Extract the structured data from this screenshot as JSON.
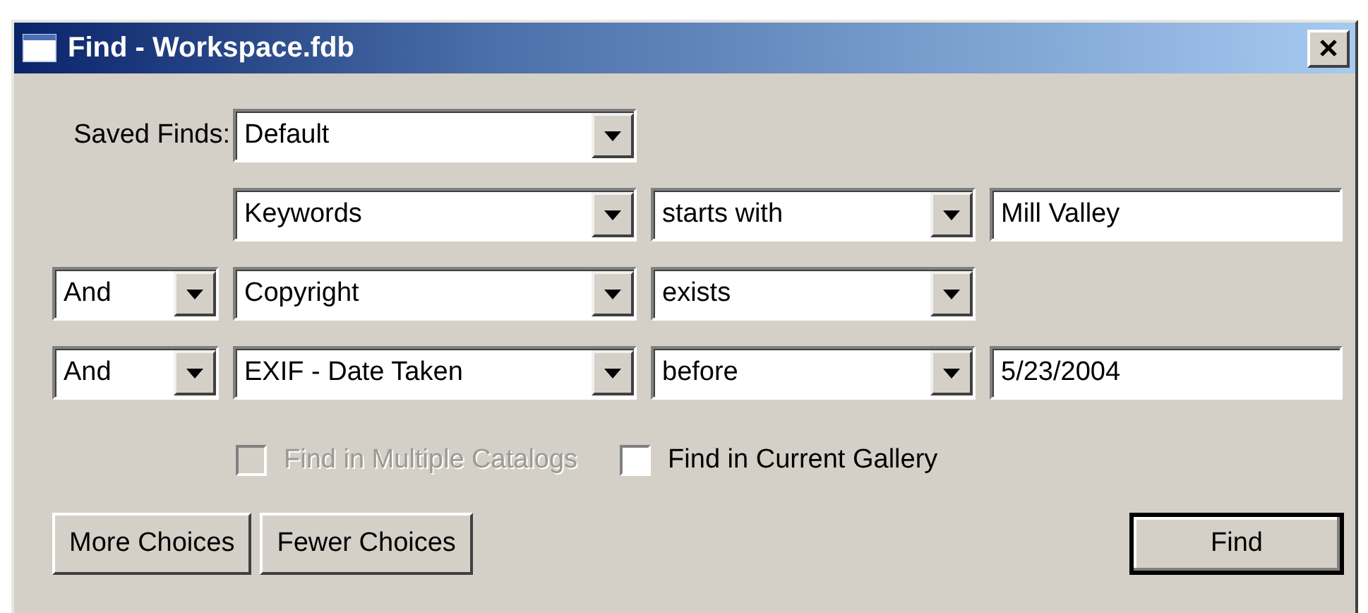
{
  "window": {
    "title": "Find - Workspace.fdb"
  },
  "saved_finds": {
    "label": "Saved Finds:",
    "value": "Default"
  },
  "criteria": [
    {
      "field": "Keywords",
      "operator": "starts with",
      "value": "Mill Valley"
    },
    {
      "conjunction": "And",
      "field": "Copyright",
      "operator": "exists"
    },
    {
      "conjunction": "And",
      "field": "EXIF - Date Taken",
      "operator": "before",
      "value": "5/23/2004"
    }
  ],
  "options": [
    {
      "label": "Find in Multiple Catalogs",
      "checked": false,
      "disabled": true
    },
    {
      "label": "Find in Current Gallery",
      "checked": false,
      "disabled": false
    }
  ],
  "buttons": [
    {
      "label": "More Choices",
      "kind": "normal"
    },
    {
      "label": "Fewer Choices",
      "kind": "normal"
    },
    {
      "label": "Find",
      "kind": "default"
    }
  ]
}
